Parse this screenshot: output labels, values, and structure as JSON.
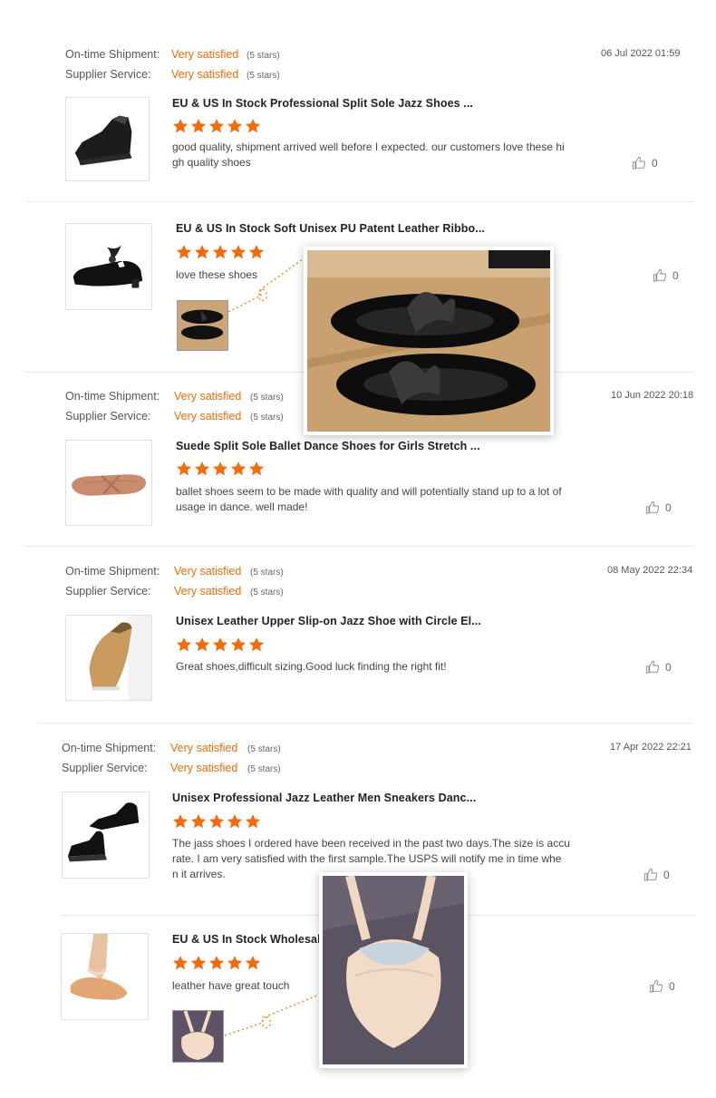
{
  "labels": {
    "ontime": "On-time Shipment:",
    "supplier": "Supplier Service:",
    "very_satisfied": "Very satisfied",
    "five_stars": "(5 stars)"
  },
  "colors": {
    "accent": "#f36b0a",
    "divider": "#e6e6e6"
  },
  "reviews": [
    {
      "date": "06 Jul 2022 01:59",
      "product": "EU & US In Stock Professional Split Sole Jazz Shoes ...",
      "rating": 5,
      "text_line1": "good quality, shipment arrived well before I expected. our customers love these hi",
      "text_line2": "gh quality shoes",
      "likes": "0",
      "thumb_icon": "black-jazz-shoe-image"
    },
    {
      "product": "EU & US In Stock Soft Unisex PU Patent Leather Ribbo...",
      "rating": 5,
      "text_line1": "love these shoes",
      "likes": "0",
      "thumb_icon": "patent-tap-shoe-image"
    },
    {
      "date": "10 Jun 2022 20:18",
      "product": "Suede Split Sole Ballet Dance Shoes for Girls Stretch ...",
      "rating": 5,
      "text_line1": "ballet shoes seem to be made with quality and will potentially stand up to a lot of",
      "text_line2": "usage in dance. well made!",
      "likes": "0",
      "thumb_icon": "suede-ballet-shoe-image"
    },
    {
      "date": "08 May 2022 22:34",
      "product": "Unisex Leather Upper Slip-on Jazz Shoe with Circle El...",
      "rating": 5,
      "text_line1": "Great shoes,difficult sizing.Good luck finding the right fit!",
      "likes": "0",
      "thumb_icon": "tan-jazz-shoe-image"
    },
    {
      "date": "17 Apr 2022 22:21",
      "product": "Unisex Professional Jazz Leather Men Sneakers Danc...",
      "rating": 5,
      "text_line1": "The jass shoes I ordered have been received in the past two days.The size is accu",
      "text_line2": "rate. I am very satisfied with the first sample.The USPS will notify me in time whe",
      "text_line3": "n it arrives.",
      "likes": "0",
      "thumb_icon": "black-jazz-sneaker-image"
    },
    {
      "product": "EU & US In Stock Wholesale",
      "rating": 5,
      "text_line1": "leather have great touch",
      "likes": "0",
      "thumb_icon": "foot-undeez-image"
    }
  ]
}
